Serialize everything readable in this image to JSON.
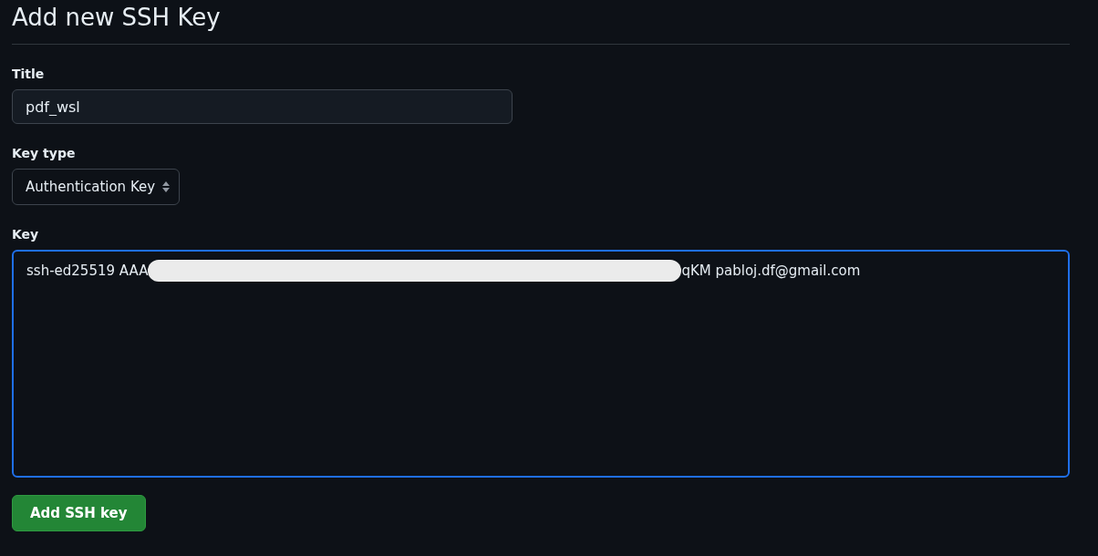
{
  "heading": "Add new SSH Key",
  "title_field": {
    "label": "Title",
    "value": "pdf_wsl"
  },
  "key_type": {
    "label": "Key type",
    "value": "Authentication Key"
  },
  "key_field": {
    "label": "Key",
    "value_start": "ssh-ed25519 AAA",
    "redacted": true,
    "value_end": "qKM pabloj.df@gmail.com",
    "focused": true
  },
  "submit": {
    "label": "Add SSH key"
  }
}
